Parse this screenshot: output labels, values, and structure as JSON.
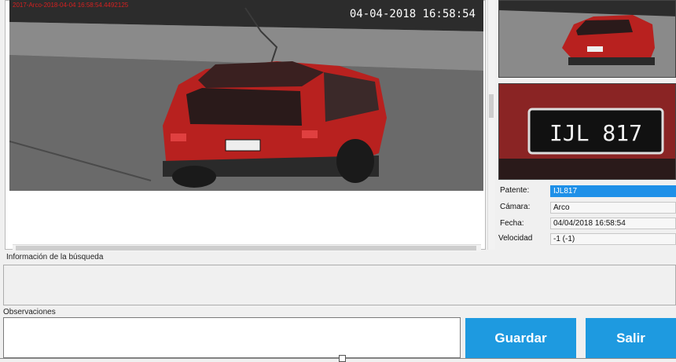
{
  "camera": {
    "overlay_meta": "2017-Arco-2018-04-04 16:58:54.4492125",
    "overlay_timestamp": "04-04-2018  16:58:54"
  },
  "plate_crop_text": "IJL 817",
  "details": {
    "patente_label": "Patente:",
    "patente_value": "IJL817",
    "camara_label": "Cámara:",
    "camara_value": "Arco",
    "fecha_label": "Fecha:",
    "fecha_value": "04/04/2018 16:58:54",
    "velocidad_label": "Velocidad",
    "velocidad_value": "-1  (-1)"
  },
  "search_info": {
    "label": "Información de la búsqueda"
  },
  "observations": {
    "label": "Observaciones",
    "value": ""
  },
  "buttons": {
    "save_label": "Guardar",
    "exit_label": "Salir"
  },
  "colors": {
    "accent": "#1e9ae0",
    "selection": "#1e90e8",
    "car_body": "#b8211f"
  }
}
